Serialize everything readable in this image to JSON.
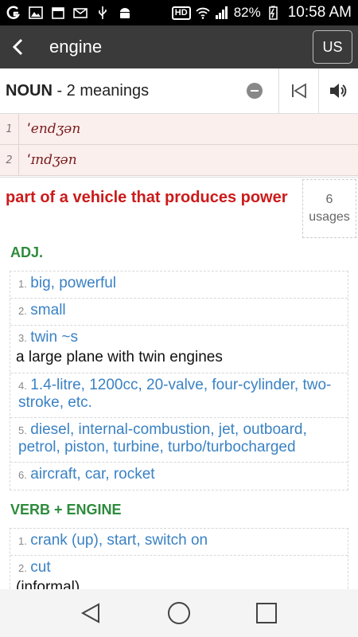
{
  "status_bar": {
    "battery": "82%",
    "time": "10:58 AM",
    "hd_label": "HD"
  },
  "action_bar": {
    "title": "engine",
    "lang_button": "US"
  },
  "pos_header": {
    "pos": "NOUN",
    "meanings": " - 2 meanings"
  },
  "pronunciations": [
    {
      "num": "1",
      "text": "ˈendʒən"
    },
    {
      "num": "2",
      "text": "ˈɪndʒən"
    }
  ],
  "meaning": {
    "text": "part of a vehicle that produces power",
    "usages_count": "6",
    "usages_label": "usages"
  },
  "sections": [
    {
      "title": "ADJ.",
      "items": [
        {
          "num": "1.",
          "text": "big, powerful"
        },
        {
          "num": "2.",
          "text": "small"
        },
        {
          "num": "3.",
          "text": "twin ~s",
          "example": "a large plane with twin engines"
        },
        {
          "num": "4.",
          "text": "1.4-litre, 1200cc, 20-valve, four-cylinder, two-stroke, etc."
        },
        {
          "num": "5.",
          "text": "diesel, internal-combustion, jet, outboard, petrol, piston, turbine, turbo/turbocharged"
        },
        {
          "num": "6.",
          "text": "aircraft, car, rocket"
        }
      ]
    },
    {
      "title": "VERB + ENGINE",
      "items": [
        {
          "num": "1.",
          "text": "crank (up), start, switch on"
        },
        {
          "num": "2.",
          "text": "cut",
          "example": "(informal)"
        }
      ]
    }
  ]
}
